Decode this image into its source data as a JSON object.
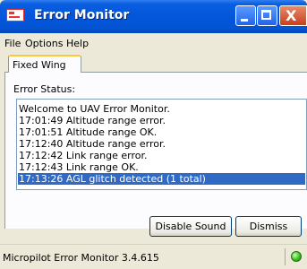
{
  "window": {
    "title": "Error Monitor",
    "app_icon": "app-icon",
    "controls": [
      "minimize-icon",
      "maximize-icon",
      "close-icon"
    ],
    "close_glyph": "X"
  },
  "menu": {
    "items": [
      {
        "label": "File"
      },
      {
        "label": "Options"
      },
      {
        "label": "Help"
      }
    ]
  },
  "tabs": [
    {
      "label": "Fixed Wing",
      "active": true
    }
  ],
  "error_status": {
    "label": "Error Status:",
    "log": [
      {
        "text": "Welcome to UAV Error Monitor.",
        "selected": false
      },
      {
        "text": "17:01:49 Altitude range error.",
        "selected": false
      },
      {
        "text": "17:01:51 Altitude range OK.",
        "selected": false
      },
      {
        "text": "17:12:40 Altitude range error.",
        "selected": false
      },
      {
        "text": "17:12:42 Link range error.",
        "selected": false
      },
      {
        "text": "17:12:43 Link range OK.",
        "selected": false
      },
      {
        "text": "17:13:26 AGL glitch detected (1 total)",
        "selected": true
      }
    ]
  },
  "buttons": {
    "disable_sound": "Disable Sound",
    "dismiss": "Dismiss"
  },
  "statusbar": {
    "text": "Micropilot Error Monitor 3.4.615",
    "indicator_color": "#3ac422"
  }
}
